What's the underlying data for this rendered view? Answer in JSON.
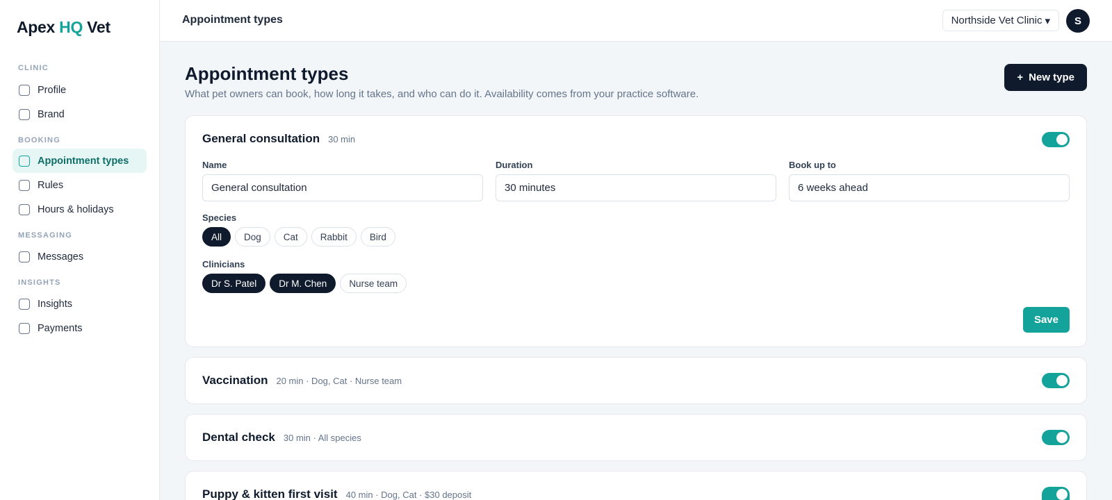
{
  "brand": {
    "part1": "Apex",
    "part2": "HQ",
    "part3": "Vet",
    "accent_color": "#14a39a",
    "dark_color": "#0f1b2d"
  },
  "sidebar": {
    "sections": [
      {
        "title": "CLINIC",
        "items": [
          {
            "label": "Profile"
          },
          {
            "label": "Brand"
          }
        ]
      },
      {
        "title": "BOOKING",
        "items": [
          {
            "label": "Appointment types",
            "active": true
          },
          {
            "label": "Rules"
          },
          {
            "label": "Hours & holidays"
          }
        ]
      },
      {
        "title": "MESSAGING",
        "items": [
          {
            "label": "Messages"
          }
        ]
      },
      {
        "title": "INSIGHTS",
        "items": [
          {
            "label": "Insights"
          },
          {
            "label": "Payments"
          }
        ]
      }
    ]
  },
  "topbar": {
    "title": "Appointment types",
    "clinic": "Northside Vet Clinic",
    "clinic_caret": "▾",
    "avatar_initial": "S"
  },
  "header": {
    "title": "Appointment types",
    "subtitle": "What pet owners can book, how long it takes, and who can do it. Availability comes from your practice software.",
    "new_button_icon": "+",
    "new_button_label": "New type"
  },
  "expanded": {
    "name": "General consultation",
    "meta": "30 min",
    "enabled": true,
    "fields": {
      "name_label": "Name",
      "name_value": "General consultation",
      "duration_label": "Duration",
      "duration_value": "30 minutes",
      "bookahead_label": "Book up to",
      "bookahead_value": "6 weeks ahead"
    },
    "species_label": "Species",
    "species": [
      {
        "label": "All",
        "on": true
      },
      {
        "label": "Dog"
      },
      {
        "label": "Cat"
      },
      {
        "label": "Rabbit"
      },
      {
        "label": "Bird"
      }
    ],
    "clinicians_label": "Clinicians",
    "clinicians": [
      {
        "label": "Dr S. Patel",
        "on": true
      },
      {
        "label": "Dr M. Chen",
        "on": true
      },
      {
        "label": "Nurse team"
      }
    ],
    "save_label": "Save"
  },
  "collapsed": [
    {
      "name": "Vaccination",
      "meta": "20 min · Dog, Cat · Nurse team",
      "enabled": true
    },
    {
      "name": "Dental check",
      "meta": "30 min · All species",
      "enabled": true
    },
    {
      "name": "Puppy & kitten first visit",
      "meta": "40 min · Dog, Cat · $30 deposit",
      "enabled": true
    }
  ]
}
